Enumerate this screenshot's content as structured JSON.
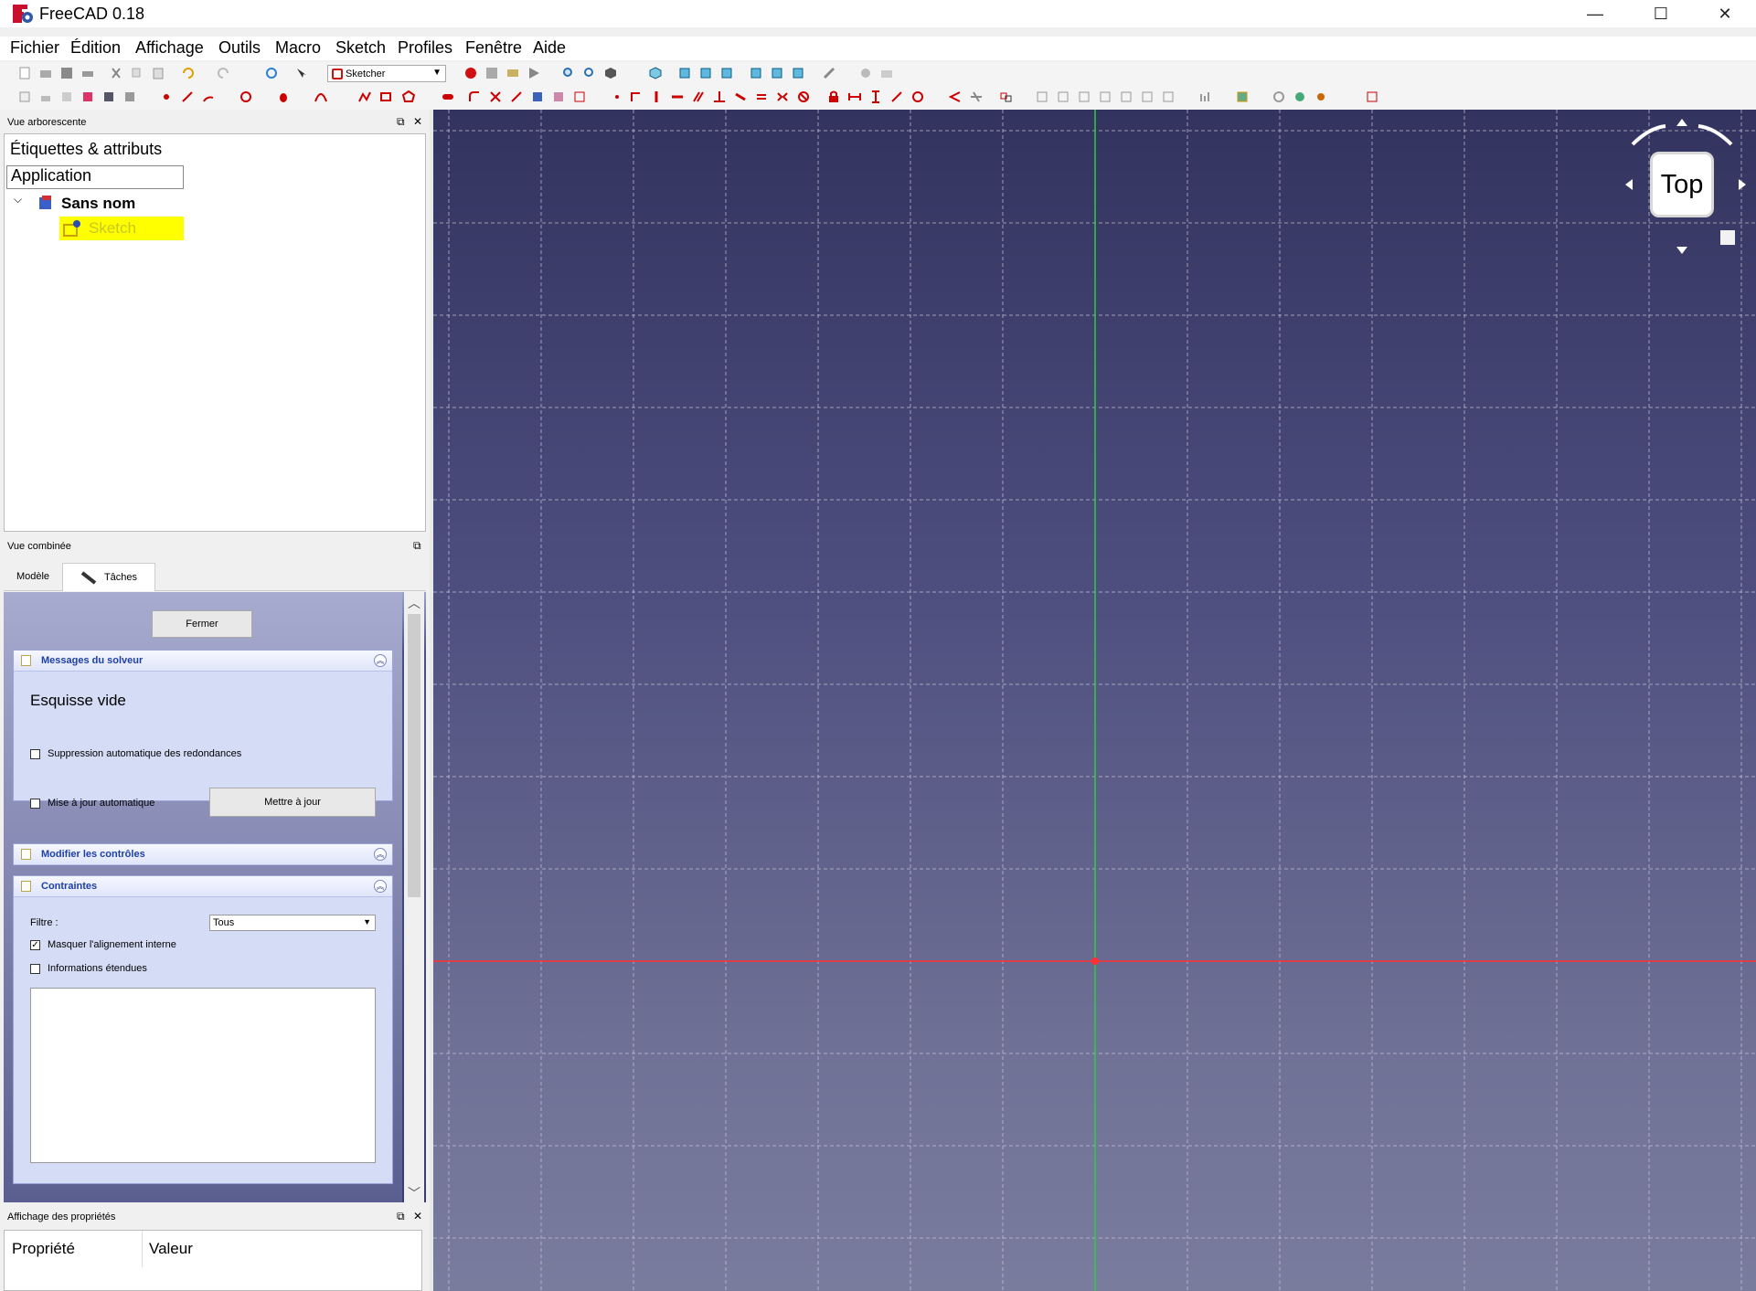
{
  "window": {
    "title": "FreeCAD 0.18",
    "minimize": "—",
    "maximize": "☐",
    "close": "✕"
  },
  "menu": [
    "Fichier",
    "Édition",
    "Affichage",
    "Outils",
    "Macro",
    "Sketch",
    "Profiles",
    "Fenêtre",
    "Aide"
  ],
  "toolbar": {
    "workbench": "Sketcher"
  },
  "tree_view": {
    "title": "Vue arborescente",
    "header_label": "Étiquettes & attributs",
    "root": "Application",
    "document": "Sans nom",
    "item": "Sketch",
    "item_highlight": "#ffff00",
    "item_text_color": "#c8c820"
  },
  "combo_view": {
    "title": "Vue combinée",
    "tabs": [
      "Modèle",
      "Tâches"
    ],
    "close_button": "Fermer",
    "solver_panel": {
      "title": "Messages du solveur",
      "message": "Esquisse vide",
      "auto_remove": "Suppression automatique des redondances",
      "auto_update": "Mise à jour automatique",
      "update_button": "Mettre à jour"
    },
    "edit_controls_panel": {
      "title": "Modifier les contrôles"
    },
    "constraints_panel": {
      "title": "Contraintes",
      "filter_label": "Filtre :",
      "filter_value": "Tous",
      "hide_internal": "Masquer l'alignement interne",
      "hide_internal_checked": true,
      "extended_info": "Informations étendues"
    }
  },
  "properties_view": {
    "title": "Affichage des propriétés",
    "col_property": "Propriété",
    "col_value": "Valeur"
  },
  "view3d": {
    "navcube_face": "Top",
    "x_axis_color": "#ff3030",
    "y_axis_color": "#2ecc40",
    "grid_color": "#c8c8d8"
  }
}
